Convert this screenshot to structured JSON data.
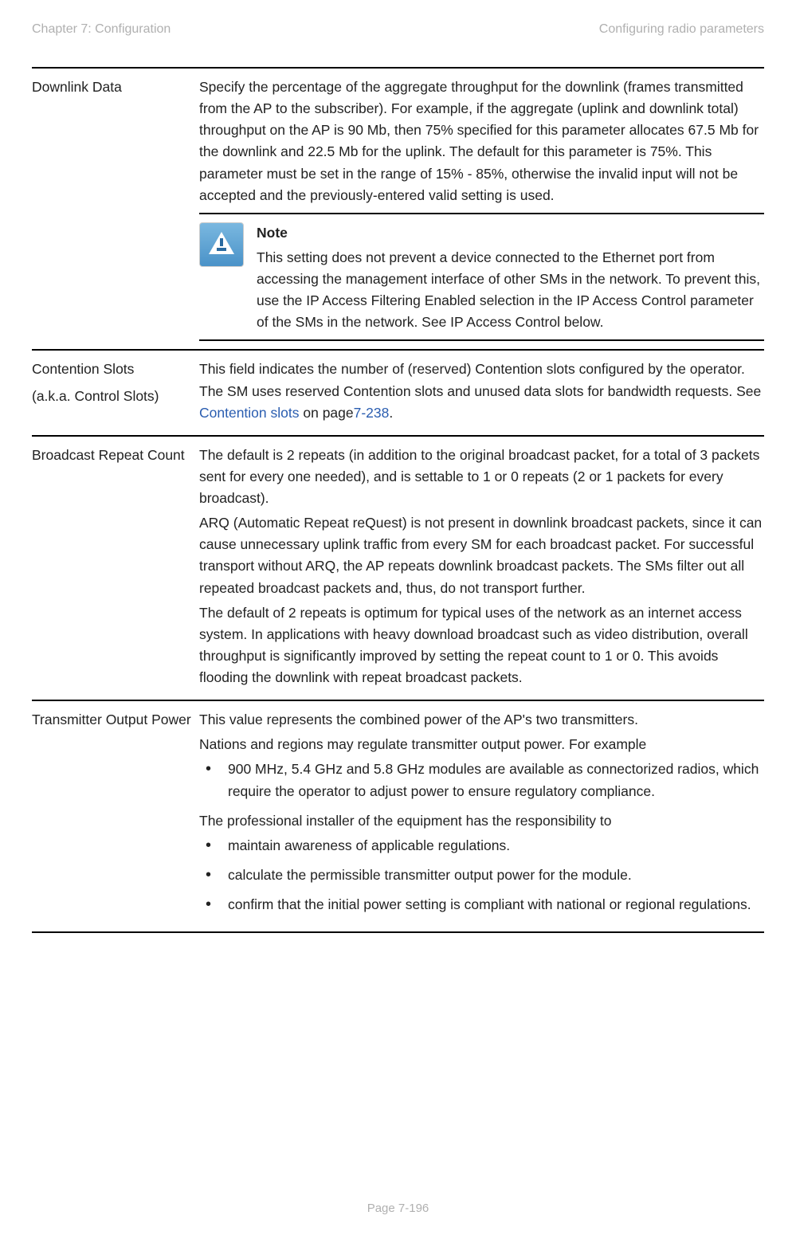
{
  "header": {
    "left": "Chapter 7:  Configuration",
    "right": "Configuring radio parameters"
  },
  "rows": {
    "downlink": {
      "label": "Downlink Data",
      "content": "Specify the percentage of the aggregate throughput for the downlink (frames transmitted from the AP to the subscriber). For example, if the aggregate (uplink and downlink total) throughput on the AP is 90 Mb, then 75% specified for this parameter allocates 67.5 Mb for the downlink and 22.5 Mb for the uplink. The default for this parameter is 75%. This parameter must be set in the range of 15% - 85%, otherwise the invalid input will not be accepted and the previously-entered valid setting is used.",
      "note_title": "Note",
      "note_body": "This setting does not prevent a device connected to the Ethernet port from accessing the management interface of other SMs in the network. To prevent this, use the IP Access Filtering Enabled selection in the IP Access Control parameter of the SMs in the network. See IP Access Control below."
    },
    "contention": {
      "label_line1": "Contention Slots",
      "label_line2": "(a.k.a. Control Slots)",
      "content_before": "This field indicates the number of (reserved) Contention slots configured by the operator. The SM uses reserved Contention slots and unused data slots for bandwidth requests. See ",
      "link_text": "Contention slots",
      "content_mid": " on page",
      "page_ref": "7-238",
      "content_after": "."
    },
    "broadcast": {
      "label": "Broadcast Repeat Count",
      "p1": "The default is 2 repeats (in addition to the original broadcast packet, for a total of 3 packets sent for every one needed), and is settable to 1 or 0 repeats (2 or 1 packets for every broadcast).",
      "p2": "ARQ (Automatic Repeat reQuest) is not present in downlink broadcast packets, since it can cause unnecessary uplink traffic from every SM for each broadcast packet. For successful transport without ARQ, the AP repeats downlink broadcast packets. The SMs filter out all repeated broadcast packets and, thus, do not transport further.",
      "p3": "The default of 2 repeats is optimum for typical uses of the network as an internet access system. In applications with heavy download broadcast such as video distribution, overall throughput is significantly improved by setting the repeat count to 1 or 0. This avoids flooding the downlink with repeat broadcast packets."
    },
    "transmitter": {
      "label": "Transmitter Output Power",
      "p1": "This value represents the combined power of the AP's two transmitters.",
      "p2": "Nations and regions may regulate transmitter output power. For example",
      "bullet1": "900 MHz, 5.4 GHz and 5.8 GHz modules are available as connectorized radios, which require the operator to adjust power to ensure regulatory compliance.",
      "p3": "The professional installer of the equipment has the responsibility to",
      "bullet2": "maintain awareness of applicable regulations.",
      "bullet3": "calculate the permissible transmitter output power for the module.",
      "bullet4": "confirm that the initial power setting is compliant with national or regional regulations."
    }
  },
  "footer": "Page 7-196"
}
